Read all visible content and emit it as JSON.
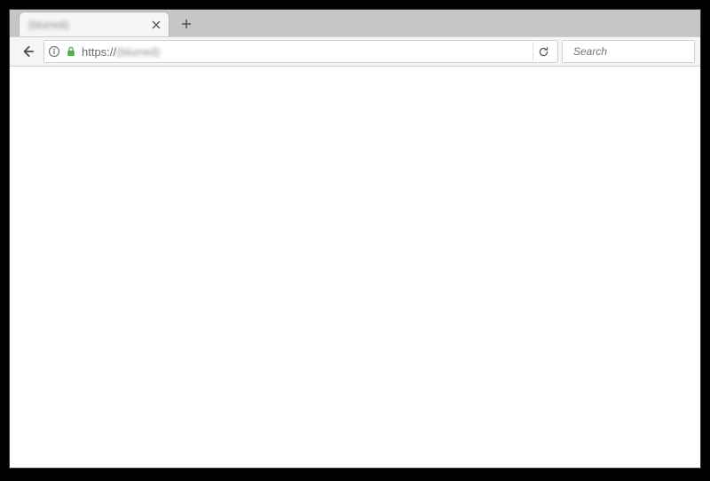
{
  "tabstrip": {
    "active_tab_title": "(blurred)",
    "close_tooltip": "Close Tab",
    "new_tab_tooltip": "Open a new tab"
  },
  "toolbar": {
    "back_tooltip": "Go back one page",
    "url_scheme": "https://",
    "url_rest": "(blurred)",
    "reload_tooltip": "Reload current page",
    "search_placeholder": "Search"
  }
}
